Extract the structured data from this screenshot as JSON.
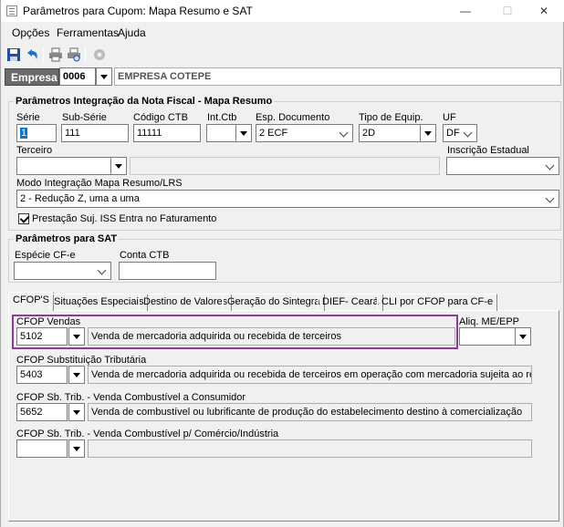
{
  "window": {
    "title": "Parâmetros para Cupom: Mapa Resumo e SAT",
    "minimize": "—",
    "maximize": "☐",
    "close": "✕"
  },
  "menu": {
    "items": [
      "Opções",
      "Ferramentas",
      "Ajuda"
    ]
  },
  "toolbar": {
    "icons": [
      "save-icon",
      "undo-icon",
      "print-icon",
      "print-preview-icon",
      "settings-icon"
    ]
  },
  "empresa": {
    "label": "Empresa",
    "code": "0006",
    "name": "EMPRESA COTEPE"
  },
  "mapa_resumo": {
    "title": "Parâmetros Integração da Nota Fiscal - Mapa Resumo",
    "serie": {
      "label": "Série",
      "value": "1"
    },
    "subserie": {
      "label": "Sub-Série",
      "value": "111"
    },
    "codigo_ctb": {
      "label": "Código CTB",
      "value": "11111"
    },
    "int_ctb": {
      "label": "Int.Ctb",
      "value": ""
    },
    "esp_documento": {
      "label": "Esp. Documento",
      "value": "2 ECF"
    },
    "tipo_equip": {
      "label": "Tipo de Equip.",
      "value": "2D"
    },
    "uf": {
      "label": "UF",
      "value": "DF"
    },
    "terceiro": {
      "label": "Terceiro",
      "value": "",
      "name": ""
    },
    "inscricao_estadual": {
      "label": "Inscrição Estadual",
      "value": ""
    },
    "modo_integracao": {
      "label": "Modo Integração Mapa Resumo/LRS",
      "value": "2 - Redução Z, uma a uma"
    },
    "prestacao_iss": {
      "label": "Prestação Suj. ISS Entra no Faturamento",
      "checked": true
    }
  },
  "sat": {
    "title": "Parâmetros para SAT",
    "especie": {
      "label": "Espécie CF-e",
      "value": ""
    },
    "conta_ctb": {
      "label": "Conta CTB",
      "value": ""
    }
  },
  "tabs": [
    {
      "label": "CFOP'S",
      "active": true
    },
    {
      "label": "Situações Especiais"
    },
    {
      "label": "Destino de Valores"
    },
    {
      "label": "Geração do Sintegra"
    },
    {
      "label": "DIEF- Ceará"
    },
    {
      "label": "CLI por CFOP para CF-e"
    }
  ],
  "cfop": {
    "vendas": {
      "label": "CFOP Vendas",
      "code": "5102",
      "description": "Venda de mercadoria adquirida ou recebida de terceiros"
    },
    "aliq_me": {
      "label": "Aliq. ME/EPP",
      "value": ""
    },
    "subst_trib": {
      "label": "CFOP Substituição Tributária",
      "code": "5403",
      "description": "Venda de mercadoria adquirida ou recebida de terceiros em operação com mercadoria sujeita ao regime de s"
    },
    "comb_consumidor": {
      "label": "CFOP Sb. Trib. - Venda Combustível a Consumidor",
      "code": "5652",
      "description": "Venda de combustível ou lubrificante de produção do estabelecimento destino à comercialização"
    },
    "comb_comercio": {
      "label": "CFOP Sb. Trib. - Venda Combustível p/ Comércio/Indústria",
      "code": "",
      "description": ""
    }
  },
  "colors": {
    "highlight": "#8e3a9a",
    "empresa_bg": "#6a6a6a",
    "selection": "#0078d7"
  }
}
